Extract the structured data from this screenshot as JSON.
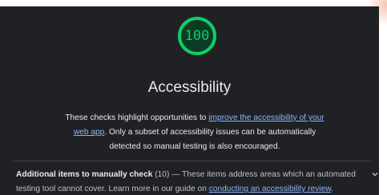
{
  "category": {
    "score": "100",
    "score_fraction": 1.0,
    "title": "Accessibility",
    "description": {
      "before": "These checks highlight opportunities to ",
      "link": "improve the accessibility of your web app",
      "after": ". Only a subset of accessibility issues can be automatically detected so manual testing is also encouraged."
    }
  },
  "manual_checks": {
    "title": "Additional items to manually check",
    "count": "(10)",
    "dash": " — ",
    "text_before": "These items address areas which an automated testing tool cannot cover. Learn more in our guide on ",
    "link": "conducting an accessibility review",
    "text_after": "."
  },
  "icons": {
    "expand": "chevron-down-icon"
  },
  "colors": {
    "panel_bg": "#202124",
    "pass_green": "#0cce6b",
    "link_blue": "#8ab4f8",
    "text": "#e8eaed"
  }
}
